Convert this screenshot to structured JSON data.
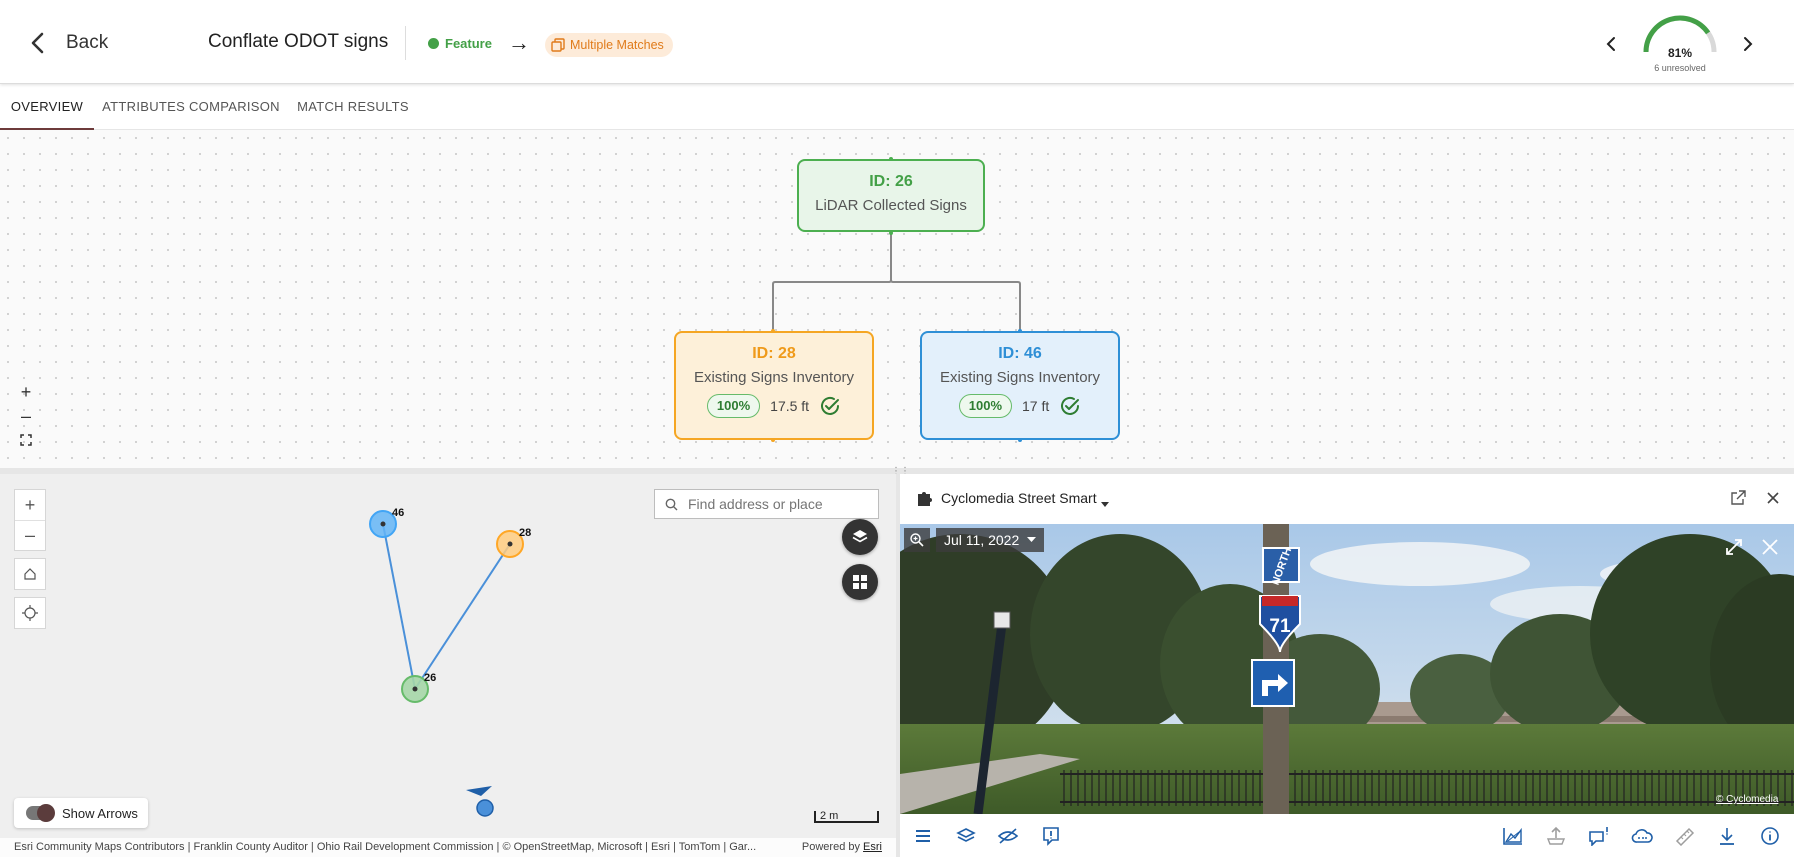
{
  "header": {
    "back_label": "Back",
    "title": "Conflate ODOT signs",
    "feature_label": "Feature",
    "match_label": "Multiple Matches",
    "progress": {
      "percent_label": "81%",
      "percent_value": 81,
      "unresolved_label": "6 unresolved"
    }
  },
  "tabs": [
    {
      "label": "OVERVIEW",
      "active": true
    },
    {
      "label": "ATTRIBUTES COMPARISON",
      "active": false
    },
    {
      "label": "MATCH RESULTS",
      "active": false
    }
  ],
  "diagram": {
    "root": {
      "id_label": "ID: 26",
      "source": "LiDAR Collected Signs"
    },
    "matches": [
      {
        "id_label": "ID: 28",
        "source": "Existing Signs Inventory",
        "score": "100%",
        "distance": "17.5 ft"
      },
      {
        "id_label": "ID: 46",
        "source": "Existing Signs Inventory",
        "score": "100%",
        "distance": "17 ft"
      }
    ],
    "controls": [
      "zoom-in",
      "zoom-out",
      "fit"
    ]
  },
  "map": {
    "search_placeholder": "Find address or place",
    "points": [
      {
        "label": "46",
        "color": "#64b5f6"
      },
      {
        "label": "28",
        "color": "#ffb74d"
      },
      {
        "label": "26",
        "color": "#81c784"
      }
    ],
    "toggle_label": "Show Arrows",
    "scale_label": "2 m",
    "attribution": "Esri Community Maps Contributors | Franklin County Auditor | Ohio Rail Development Commission | © OpenStreetMap, Microsoft | Esri | TomTom | Gar...",
    "powered_prefix": "Powered by ",
    "powered_link": "Esri"
  },
  "streetview": {
    "title": "Cyclomedia Street Smart",
    "date": "Jul 11, 2022",
    "credit": "© Cyclomedia",
    "sign_text": {
      "north": "NORTH",
      "route": "71"
    }
  },
  "colors": {
    "root": "#4caf50",
    "match_a": "#f5a623",
    "match_b": "#2e8fd6",
    "accent_tab": "#6d3b3b",
    "gauge": "#43a047"
  }
}
